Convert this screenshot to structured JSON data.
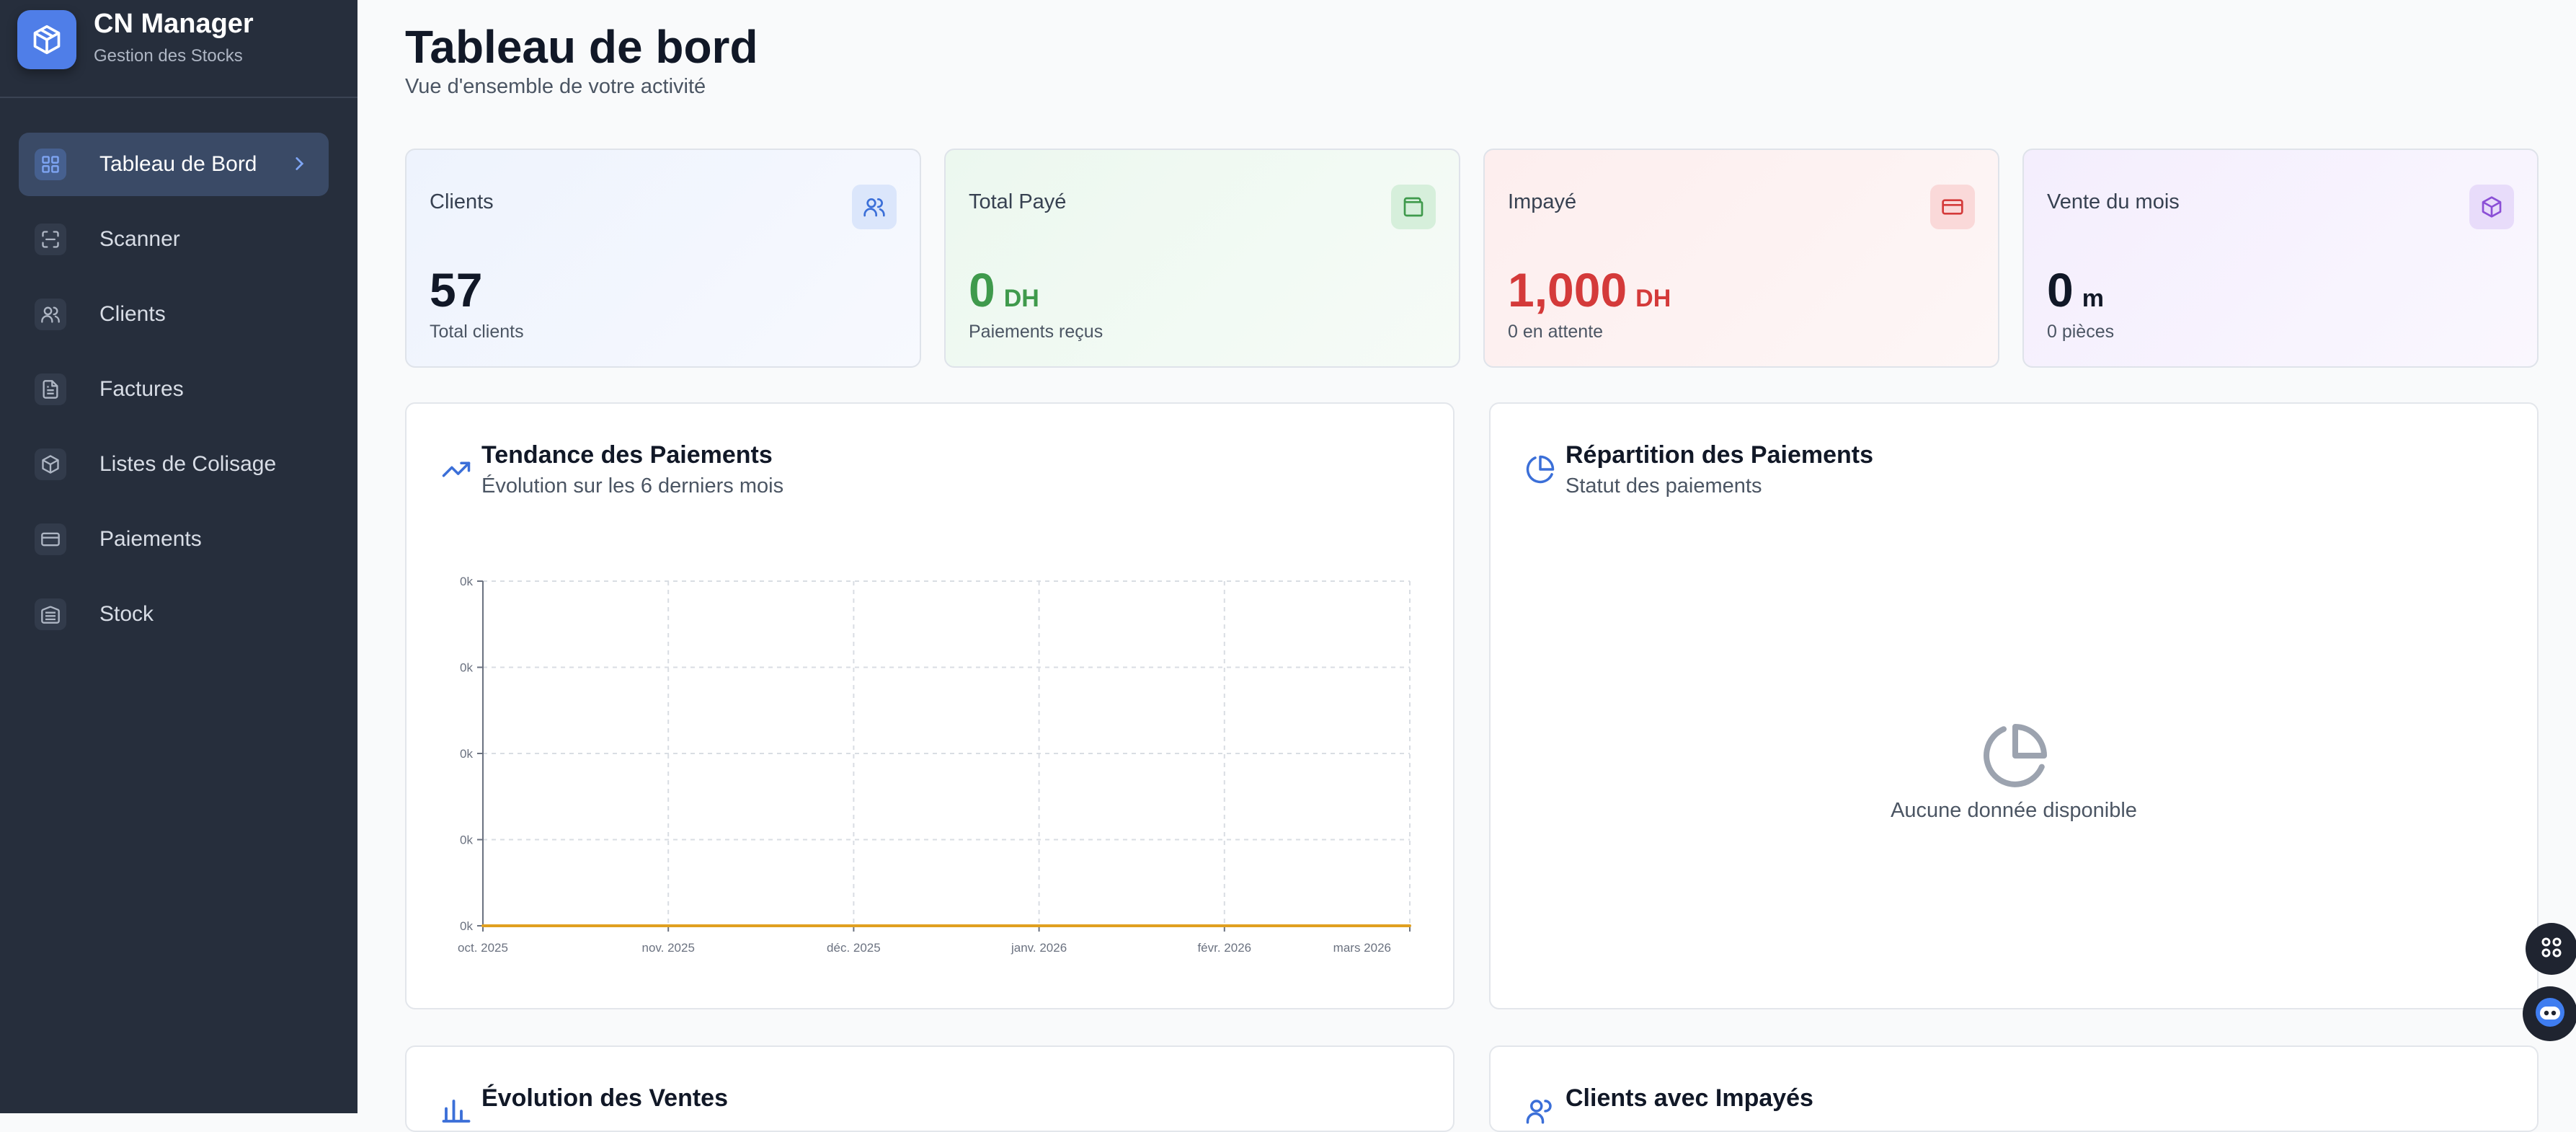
{
  "app": {
    "title": "CN Manager",
    "subtitle": "Gestion des Stocks"
  },
  "sidebar": {
    "items": [
      {
        "label": "Tableau de Bord",
        "icon": "dashboard-icon",
        "active": true
      },
      {
        "label": "Scanner",
        "icon": "scan-icon"
      },
      {
        "label": "Clients",
        "icon": "users-icon"
      },
      {
        "label": "Factures",
        "icon": "file-text-icon"
      },
      {
        "label": "Listes de Colisage",
        "icon": "package-icon"
      },
      {
        "label": "Paiements",
        "icon": "credit-card-icon"
      },
      {
        "label": "Stock",
        "icon": "warehouse-icon"
      }
    ]
  },
  "header": {
    "title": "Tableau de bord",
    "subtitle": "Vue d'ensemble de votre activité"
  },
  "stats": [
    {
      "label": "Clients",
      "value": "57",
      "unit": "",
      "sub": "Total clients",
      "icon": "users-icon",
      "color": "#111827",
      "accent": "#3b6fd8"
    },
    {
      "label": "Total Payé",
      "value": "0",
      "unit": "DH",
      "sub": "Paiements reçus",
      "icon": "wallet-icon",
      "color": "#3f9a4c",
      "accent": "#3f9a4c"
    },
    {
      "label": "Impayé",
      "value": "1,000",
      "unit": "DH",
      "sub": "0 en attente",
      "icon": "credit-card-icon",
      "color": "#d43a3a",
      "accent": "#d43a3a"
    },
    {
      "label": "Vente du mois",
      "value": "0",
      "unit": "m",
      "sub": "0 pièces",
      "icon": "package-icon",
      "color": "#111827",
      "accent": "#8b4fd6"
    }
  ],
  "trend": {
    "title": "Tendance des Paiements",
    "subtitle": "Évolution sur les 6 derniers mois",
    "icon": "trending-up-icon"
  },
  "repartition": {
    "title": "Répartition des Paiements",
    "subtitle": "Statut des paiements",
    "icon": "pie-chart-icon",
    "empty_text": "Aucune donnée disponible"
  },
  "sales": {
    "title": "Évolution des Ventes",
    "icon": "bar-chart-icon"
  },
  "unpaid_clients": {
    "title": "Clients avec Impayés",
    "icon": "users-icon"
  },
  "colors": {
    "sidebar_bg": "#262e3c",
    "accent": "#4f7ee8",
    "line": "#e0a020"
  },
  "chart_data": {
    "type": "line",
    "categories": [
      "oct. 2025",
      "nov. 2025",
      "déc. 2025",
      "janv. 2026",
      "févr. 2026",
      "mars 2026"
    ],
    "series": [
      {
        "values": [
          0,
          0,
          0,
          0,
          0,
          0
        ],
        "color": "#e0a020"
      }
    ],
    "yticks": [
      "0k",
      "0k",
      "0k",
      "0k",
      "0k"
    ],
    "ylim": [
      0,
      4
    ],
    "grid": true,
    "xlabel": "",
    "ylabel": ""
  }
}
